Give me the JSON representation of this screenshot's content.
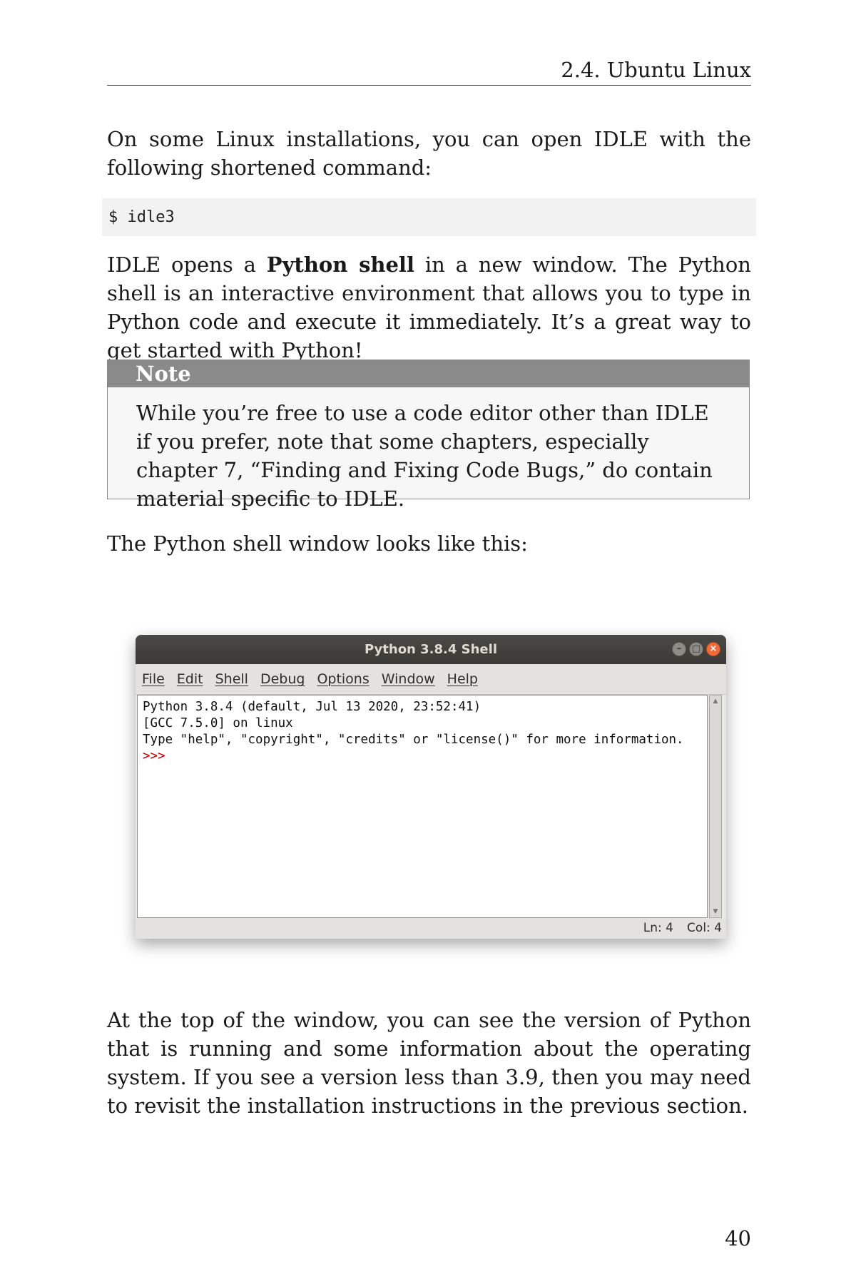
{
  "header": {
    "running_head": "2.4.  Ubuntu Linux"
  },
  "paragraphs": {
    "p1": "On some Linux installations, you can open IDLE with the following shortened command:",
    "p2_before": "IDLE opens a ",
    "p2_bold": "Python shell",
    "p2_after": " in a new window. The Python shell is an interactive environment that allows you to type in Python code and execute it immediately. It’s a great way to get started with Python!",
    "p3": "The Python shell window looks like this:",
    "p4": "At the top of the window, you can see the version of Python that is running and some information about the operating system. If you see a version less than 3.9, then you may need to revisit the installation instructions in the previous section."
  },
  "code": {
    "command": "$ idle3"
  },
  "note": {
    "title": "Note",
    "body": "While you’re free to use a code editor other than IDLE if you prefer, note that some chapters, especially chapter 7, “Finding and Fixing Code Bugs,” do contain material specific to IDLE."
  },
  "shell": {
    "title": "Python 3.8.4 Shell",
    "window_buttons": [
      "minimize-icon",
      "maximize-icon",
      "close-icon"
    ],
    "menu": [
      "File",
      "Edit",
      "Shell",
      "Debug",
      "Options",
      "Window",
      "Help"
    ],
    "lines": [
      "Python 3.8.4 (default, Jul 13 2020, 23:52:41)",
      "[GCC 7.5.0] on linux",
      "Type \"help\", \"copyright\", \"credits\" or \"license()\" for more information."
    ],
    "prompt": ">>>",
    "status_ln": "Ln: 4",
    "status_col": "Col: 4",
    "colors": {
      "titlebar": "#3c3b37",
      "prompt": "#c00000",
      "close_button": "#ef6b3a"
    }
  },
  "footer": {
    "page_number": "40"
  }
}
